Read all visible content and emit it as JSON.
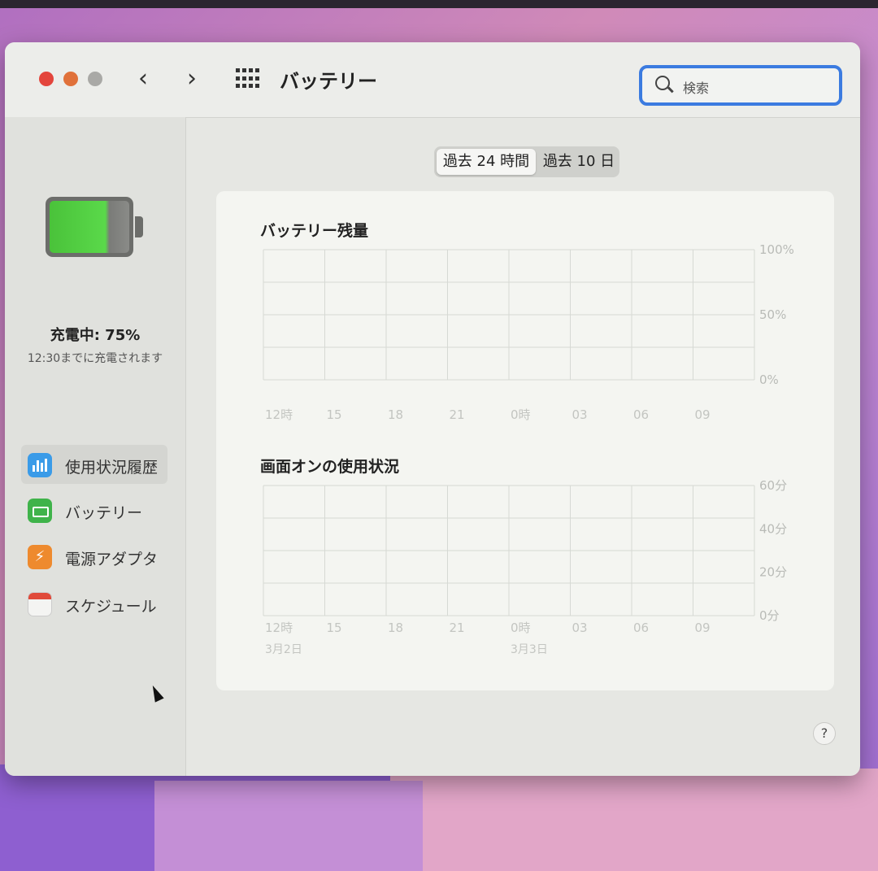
{
  "window": {
    "title": "バッテリー",
    "search_placeholder": "検索"
  },
  "status": {
    "charging": "充電中: 75%",
    "detail": "12:30までに充電されます",
    "level_percent": 75
  },
  "sidebar": {
    "items": [
      {
        "label": "使用状況履歴",
        "icon": "bar-chart-icon",
        "active": true
      },
      {
        "label": "バッテリー",
        "icon": "battery-icon",
        "active": false
      },
      {
        "label": "電源アダプタ",
        "icon": "lightning-icon",
        "active": false
      },
      {
        "label": "スケジュール",
        "icon": "calendar-icon",
        "active": false
      }
    ]
  },
  "segments": {
    "last24": "過去 24 時間",
    "last10": "過去 10 日",
    "selected": "last24"
  },
  "chart_data": [
    {
      "type": "bar",
      "title": "バッテリー残量",
      "categories": [
        "12時",
        "15",
        "18",
        "21",
        "0時",
        "03",
        "06",
        "09"
      ],
      "y_ticks": [
        "100%",
        "50%",
        "0%"
      ],
      "ylim": [
        0,
        100
      ],
      "grid": true
    },
    {
      "type": "bar",
      "title": "画面オンの使用状況",
      "categories": [
        "12時",
        "15",
        "18",
        "21",
        "0時",
        "03",
        "06",
        "09"
      ],
      "date_labels": [
        "3月2日",
        "3月3日"
      ],
      "y_ticks": [
        "60分",
        "40分",
        "20分",
        "0分"
      ],
      "ylim": [
        0,
        60
      ],
      "grid": true
    }
  ],
  "colors": {
    "accent": "#3b7be0",
    "battery_green": "#4ac23a"
  },
  "help_label": "?"
}
